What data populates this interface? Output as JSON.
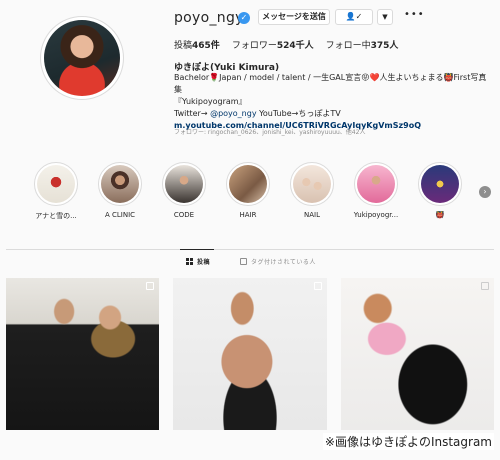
{
  "profile": {
    "username": "poyo_ngy",
    "verified_glyph": "✓",
    "message_button": "メッセージを送信",
    "follow_button": "👤✓",
    "more_button": "▼",
    "options_glyph": "•••",
    "stats": {
      "posts_label": "投稿",
      "posts_count": "465件",
      "followers_label": "フォロワー",
      "followers_count": "524千人",
      "following_label": "フォロー中",
      "following_count": "375人"
    },
    "full_name": "ゆきぽよ(Yuki Kimura)",
    "bio_line1": "Bachelor🌹Japan / model / talent / 一生GAL宣言😝❤️人生よいちょまる👹First写真集",
    "bio_line2": "『Yukipoyogram』",
    "bio_line3_prefix": "Twitter→ ",
    "bio_line3_mention": "@poyo_ngy",
    "bio_line3_suffix": " YouTube→ちっぽよTV",
    "bio_link": "m.youtube.com/channel/UC6TRiVRGcAyIqyKgVmSz9oQ",
    "followed_by": "フォロワー: ringochan_0626、jonishi_kei、yashiroyuuuu、他42人"
  },
  "highlights": [
    {
      "label": "アナと雪の..."
    },
    {
      "label": "A CLINIC"
    },
    {
      "label": "CODE"
    },
    {
      "label": "HAIR"
    },
    {
      "label": "NAIL"
    },
    {
      "label": "Yukipoyogr..."
    },
    {
      "label": "👹"
    }
  ],
  "highlight_next_glyph": "›",
  "tabs": {
    "posts": "投稿",
    "tagged": "タグ付けされている人"
  },
  "credit": "※画像はゆきぽよのInstagram",
  "colors": {
    "verified": "#3897f0",
    "link": "#00376b",
    "muted": "#8e8e8e",
    "border": "#dbdbdb"
  }
}
